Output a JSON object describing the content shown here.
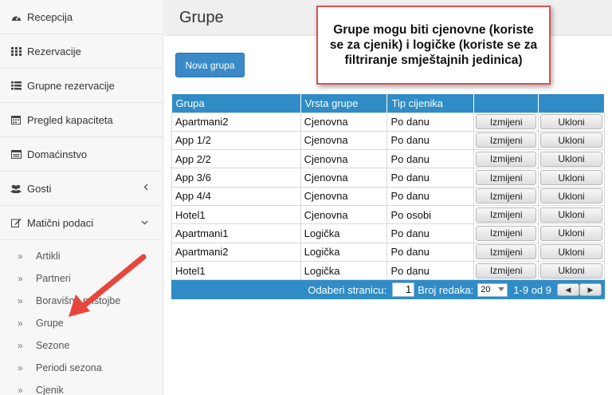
{
  "sidebar": {
    "items": [
      {
        "label": "Recepcija",
        "icon": "dashboard-icon"
      },
      {
        "label": "Rezervacije",
        "icon": "grid-icon"
      },
      {
        "label": "Grupne rezervacije",
        "icon": "list-icon"
      },
      {
        "label": "Pregled kapaciteta",
        "icon": "calendar-icon"
      },
      {
        "label": "Domaćinstvo",
        "icon": "window-icon"
      },
      {
        "label": "Gosti",
        "icon": "users-icon"
      },
      {
        "label": "Matični podaci",
        "icon": "edit-icon"
      }
    ],
    "subitems": [
      "Artikli",
      "Partneri",
      "Boravišne pristojbe",
      "Grupe",
      "Sezone",
      "Periodi sezona",
      "Cjenik"
    ]
  },
  "page": {
    "title": "Grupe"
  },
  "toolbar": {
    "new_label": "Nova grupa"
  },
  "callout": {
    "text": "Grupe mogu biti cjenovne (koriste se za cjenik) i logičke (koriste se za filtriranje smještajnih jedinica)"
  },
  "table": {
    "headers": [
      "Grupa",
      "Vrsta grupe",
      "Tip cijenika",
      "",
      ""
    ],
    "edit_label": "Izmijeni",
    "remove_label": "Ukloni",
    "rows": [
      [
        "Apartmani2",
        "Cjenovna",
        "Po danu"
      ],
      [
        "App 1/2",
        "Cjenovna",
        "Po danu"
      ],
      [
        "App 2/2",
        "Cjenovna",
        "Po danu"
      ],
      [
        "App 3/6",
        "Cjenovna",
        "Po danu"
      ],
      [
        "App 4/4",
        "Cjenovna",
        "Po danu"
      ],
      [
        "Hotel1",
        "Cjenovna",
        "Po osobi"
      ],
      [
        "Apartmani1",
        "Logička",
        "Po danu"
      ],
      [
        "Apartmani2",
        "Logička",
        "Po danu"
      ],
      [
        "Hotel1",
        "Logička",
        "Po danu"
      ]
    ]
  },
  "pager": {
    "page_label": "Odaberi stranicu:",
    "page_value": "1",
    "rows_label": "Broj redaka:",
    "rows_value": "20",
    "range_text": "1-9 od 9"
  },
  "colors": {
    "accent": "#2f8cc6",
    "callout_border": "#d9534f",
    "arrow": "#e8453c"
  }
}
